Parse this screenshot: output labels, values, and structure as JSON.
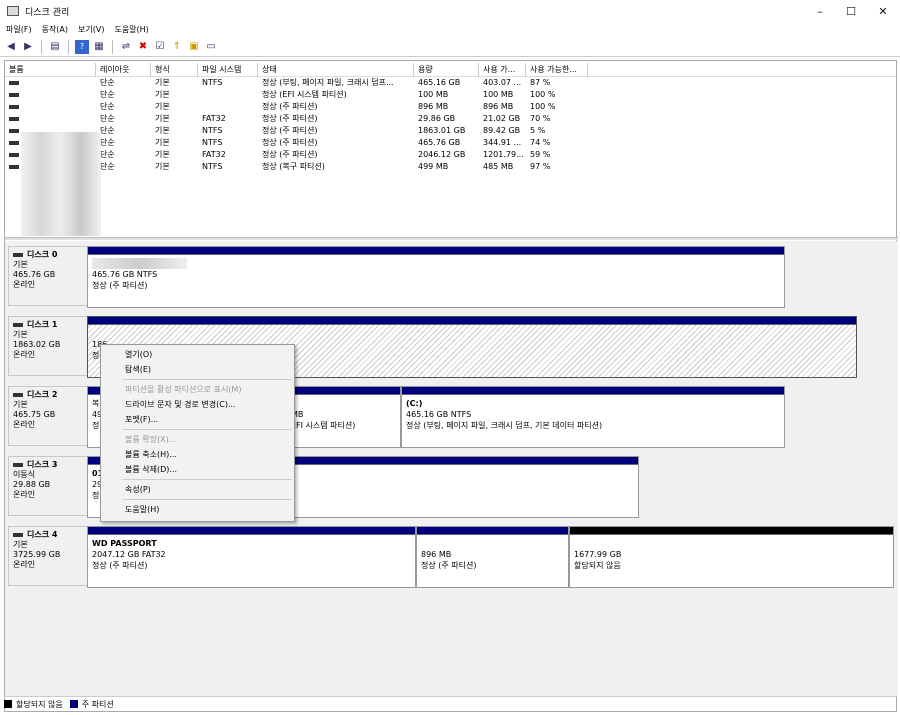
{
  "window": {
    "title": "디스크 관리",
    "minimize": "–",
    "maximize": "☐",
    "close": "✕"
  },
  "menu": [
    "파일(F)",
    "동작(A)",
    "보기(V)",
    "도움말(H)"
  ],
  "volume_table": {
    "headers": [
      "볼륨",
      "레이아웃",
      "형식",
      "파일 시스템",
      "상태",
      "용량",
      "사용 가...",
      "사용 가능한..."
    ],
    "rows": [
      {
        "layout": "단순",
        "type": "기본",
        "fs": "NTFS",
        "status": "정상 (부팅, 페이지 파일, 크래시 덤프...",
        "cap": "465.16 GB",
        "free": "403.07 ...",
        "pct": "87 %"
      },
      {
        "layout": "단순",
        "type": "기본",
        "fs": "",
        "status": "정상 (EFI 시스템 파티션)",
        "cap": "100 MB",
        "free": "100 MB",
        "pct": "100 %"
      },
      {
        "layout": "단순",
        "type": "기본",
        "fs": "",
        "status": "정상 (주 파티션)",
        "cap": "896 MB",
        "free": "896 MB",
        "pct": "100 %"
      },
      {
        "layout": "단순",
        "type": "기본",
        "fs": "FAT32",
        "status": "정상 (주 파티션)",
        "cap": "29.86 GB",
        "free": "21.02 GB",
        "pct": "70 %"
      },
      {
        "layout": "단순",
        "type": "기본",
        "fs": "NTFS",
        "status": "정상 (주 파티션)",
        "cap": "1863.01 GB",
        "free": "89.42 GB",
        "pct": "5 %"
      },
      {
        "layout": "단순",
        "type": "기본",
        "fs": "NTFS",
        "status": "정상 (주 파티션)",
        "cap": "465.76 GB",
        "free": "344.91 ...",
        "pct": "74 %"
      },
      {
        "layout": "단순",
        "type": "기본",
        "fs": "FAT32",
        "status": "정상 (주 파티션)",
        "cap": "2046.12 GB",
        "free": "1201.79...",
        "pct": "59 %"
      },
      {
        "layout": "단순",
        "type": "기본",
        "fs": "NTFS",
        "status": "정상 (복구 파티션)",
        "cap": "499 MB",
        "free": "485 MB",
        "pct": "97 %"
      }
    ]
  },
  "disks": [
    {
      "name": "디스크 0",
      "kind": "기본",
      "size": "465.76 GB",
      "state": "온라인"
    },
    {
      "name": "디스크 1",
      "kind": "기본",
      "size": "1863.02 GB",
      "state": "온라인"
    },
    {
      "name": "디스크 2",
      "kind": "기본",
      "size": "465.75 GB",
      "state": "온라인"
    },
    {
      "name": "디스크 3",
      "kind": "이동식",
      "size": "29.88 GB",
      "state": "온라인"
    },
    {
      "name": "디스크 4",
      "kind": "기본",
      "size": "3725.99 GB",
      "state": "온라인"
    }
  ],
  "partitions": {
    "d0p1": {
      "l1": "",
      "l2": "465.76 GB NTFS",
      "l3": "정상 (주 파티션)"
    },
    "d1p1": {
      "l1": "186",
      "l2": "",
      "l3": "정"
    },
    "d2p1": {
      "l1": "복",
      "l2": "49",
      "l3": "정"
    },
    "d2p2": {
      "l1": "",
      "l2": "MB",
      "l3": "EFI 시스템 파티션)"
    },
    "d2p3": {
      "l1": "(C:)",
      "l2": "465.16 GB NTFS",
      "l3": "정상 (부팅, 페이지 파일, 크래시 덤프, 기본 데이터 파티션)"
    },
    "d3p1": {
      "l1": "01",
      "l2": "29",
      "l3": "정"
    },
    "d4p1": {
      "l1": "WD PASSPORT",
      "l2": "2047.12 GB FAT32",
      "l3": "정상 (주 파티션)"
    },
    "d4p2": {
      "l1": "",
      "l2": "896 MB",
      "l3": "정상 (주 파티션)"
    },
    "d4p3": {
      "l1": "",
      "l2": "1677.99 GB",
      "l3": "할당되지 않음"
    }
  },
  "context_menu": [
    {
      "label": "열기(O)",
      "enabled": true
    },
    {
      "label": "탐색(E)",
      "enabled": true
    },
    {
      "sep": true
    },
    {
      "label": "파티션을 활성 파티션으로 표시(M)",
      "enabled": false
    },
    {
      "label": "드라이브 문자 및 경로 변경(C)...",
      "enabled": true
    },
    {
      "label": "포맷(F)...",
      "enabled": true
    },
    {
      "sep": true
    },
    {
      "label": "볼륨 확장(X)...",
      "enabled": false
    },
    {
      "label": "볼륨 축소(H)...",
      "enabled": true
    },
    {
      "label": "볼륨 삭제(D)...",
      "enabled": true
    },
    {
      "sep": true
    },
    {
      "label": "속성(P)",
      "enabled": true
    },
    {
      "sep": true
    },
    {
      "label": "도움말(H)",
      "enabled": true
    }
  ],
  "legend": {
    "unallocated": "할당되지 않음",
    "primary": "주 파티션",
    "unallocated_color": "#000000",
    "primary_color": "#00007f"
  }
}
